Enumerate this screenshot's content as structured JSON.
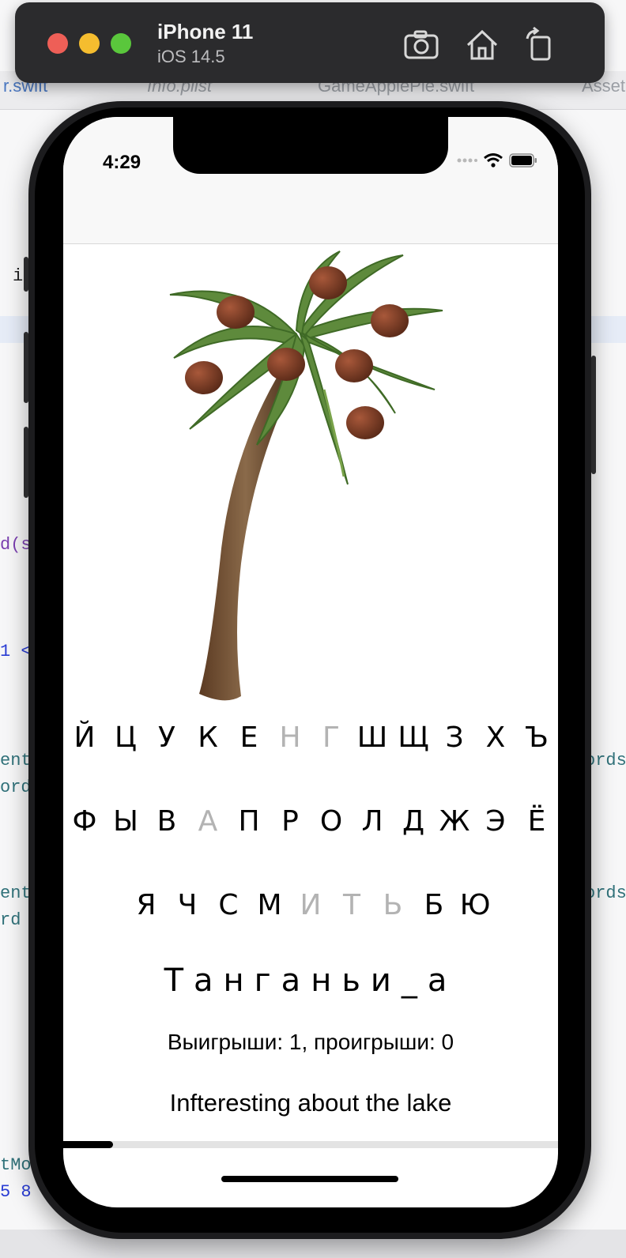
{
  "simulator": {
    "device": "iPhone 11",
    "os": "iOS 14.5",
    "traffic_lights": [
      "#ee5f57",
      "#f5bd2f",
      "#5ac73c"
    ],
    "buttons": [
      "screenshot-icon",
      "home-icon",
      "rotate-icon"
    ]
  },
  "xcode": {
    "tabs": [
      "r.swift",
      "Info.plist",
      "GameApplePie.swift",
      "Asset"
    ],
    "code_fragments": [
      "i",
      "d(s",
      "1 <",
      "ent",
      "ord",
      "ords",
      "ent",
      "rd",
      "ords",
      "tMo",
      "5 8"
    ]
  },
  "status_bar": {
    "time": "4:29"
  },
  "keyboard": {
    "rows": [
      [
        {
          "l": "Й"
        },
        {
          "l": "Ц"
        },
        {
          "l": "У"
        },
        {
          "l": "К"
        },
        {
          "l": "Е"
        },
        {
          "l": "Н",
          "used": true
        },
        {
          "l": "Г",
          "used": true
        },
        {
          "l": "Ш"
        },
        {
          "l": "Щ"
        },
        {
          "l": "З"
        },
        {
          "l": "Х"
        },
        {
          "l": "Ъ"
        }
      ],
      [
        {
          "l": "Ф"
        },
        {
          "l": "Ы"
        },
        {
          "l": "В"
        },
        {
          "l": "А",
          "used": true
        },
        {
          "l": "П"
        },
        {
          "l": "Р"
        },
        {
          "l": "О"
        },
        {
          "l": "Л"
        },
        {
          "l": "Д"
        },
        {
          "l": "Ж"
        },
        {
          "l": "Э"
        },
        {
          "l": "Ё"
        }
      ],
      [
        {
          "l": "Я"
        },
        {
          "l": "Ч"
        },
        {
          "l": "С"
        },
        {
          "l": "М"
        },
        {
          "l": "И",
          "used": true
        },
        {
          "l": "Т",
          "used": true
        },
        {
          "l": "Ь",
          "used": true
        },
        {
          "l": "Б"
        },
        {
          "l": "Ю"
        }
      ]
    ]
  },
  "game": {
    "word": "Танганьи_а",
    "score": "Выигрыши: 1, проигрыши: 0",
    "fact": "Infteresting about the lake",
    "progress": 0.1
  },
  "colors": {
    "used_key": "#b3b3b3",
    "key": "#000000"
  }
}
